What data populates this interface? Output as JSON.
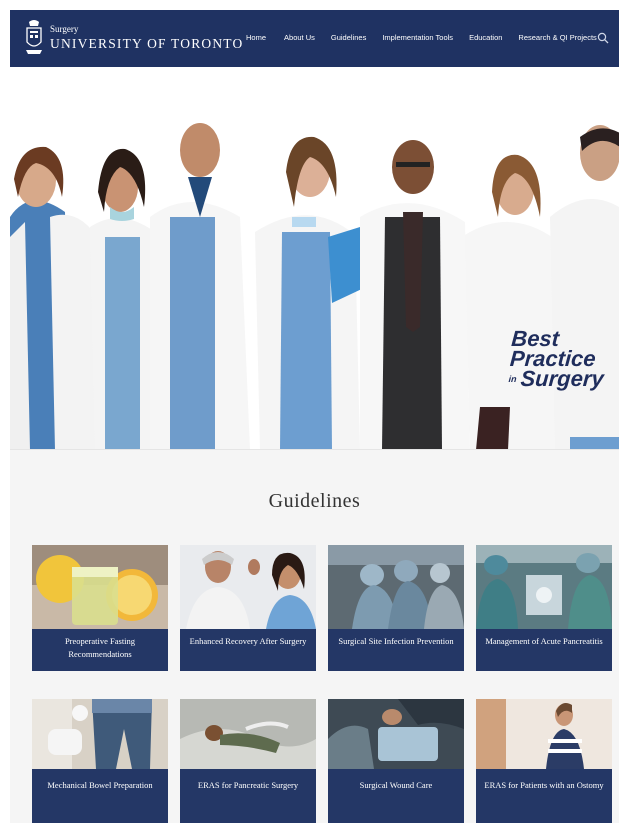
{
  "header": {
    "logo_small": "Surgery",
    "logo_big": "UNIVERSITY OF TORONTO",
    "nav": [
      "Home",
      "About Us",
      "Guidelines",
      "Implementation Tools",
      "Education",
      "Research & QI Projects"
    ]
  },
  "hero": {
    "badge_line1": "Best",
    "badge_line2": "Practice",
    "badge_in": "in",
    "badge_line3": "Surgery"
  },
  "section": {
    "title": "Guidelines"
  },
  "cards": [
    {
      "label": "Preoperative Fasting Recommendations"
    },
    {
      "label": "Enhanced Recovery After Surgery"
    },
    {
      "label": "Surgical Site Infection Prevention"
    },
    {
      "label": "Management of Acute Pancreatitis"
    },
    {
      "label": "Mechanical Bowel Preparation"
    },
    {
      "label": "ERAS for Pancreatic Surgery"
    },
    {
      "label": "Surgical Wound Care"
    },
    {
      "label": "ERAS for Patients with an Ostomy"
    }
  ],
  "colors": {
    "header": "#1f3262",
    "card_label": "#243766",
    "badge": "#1f2d5c"
  }
}
